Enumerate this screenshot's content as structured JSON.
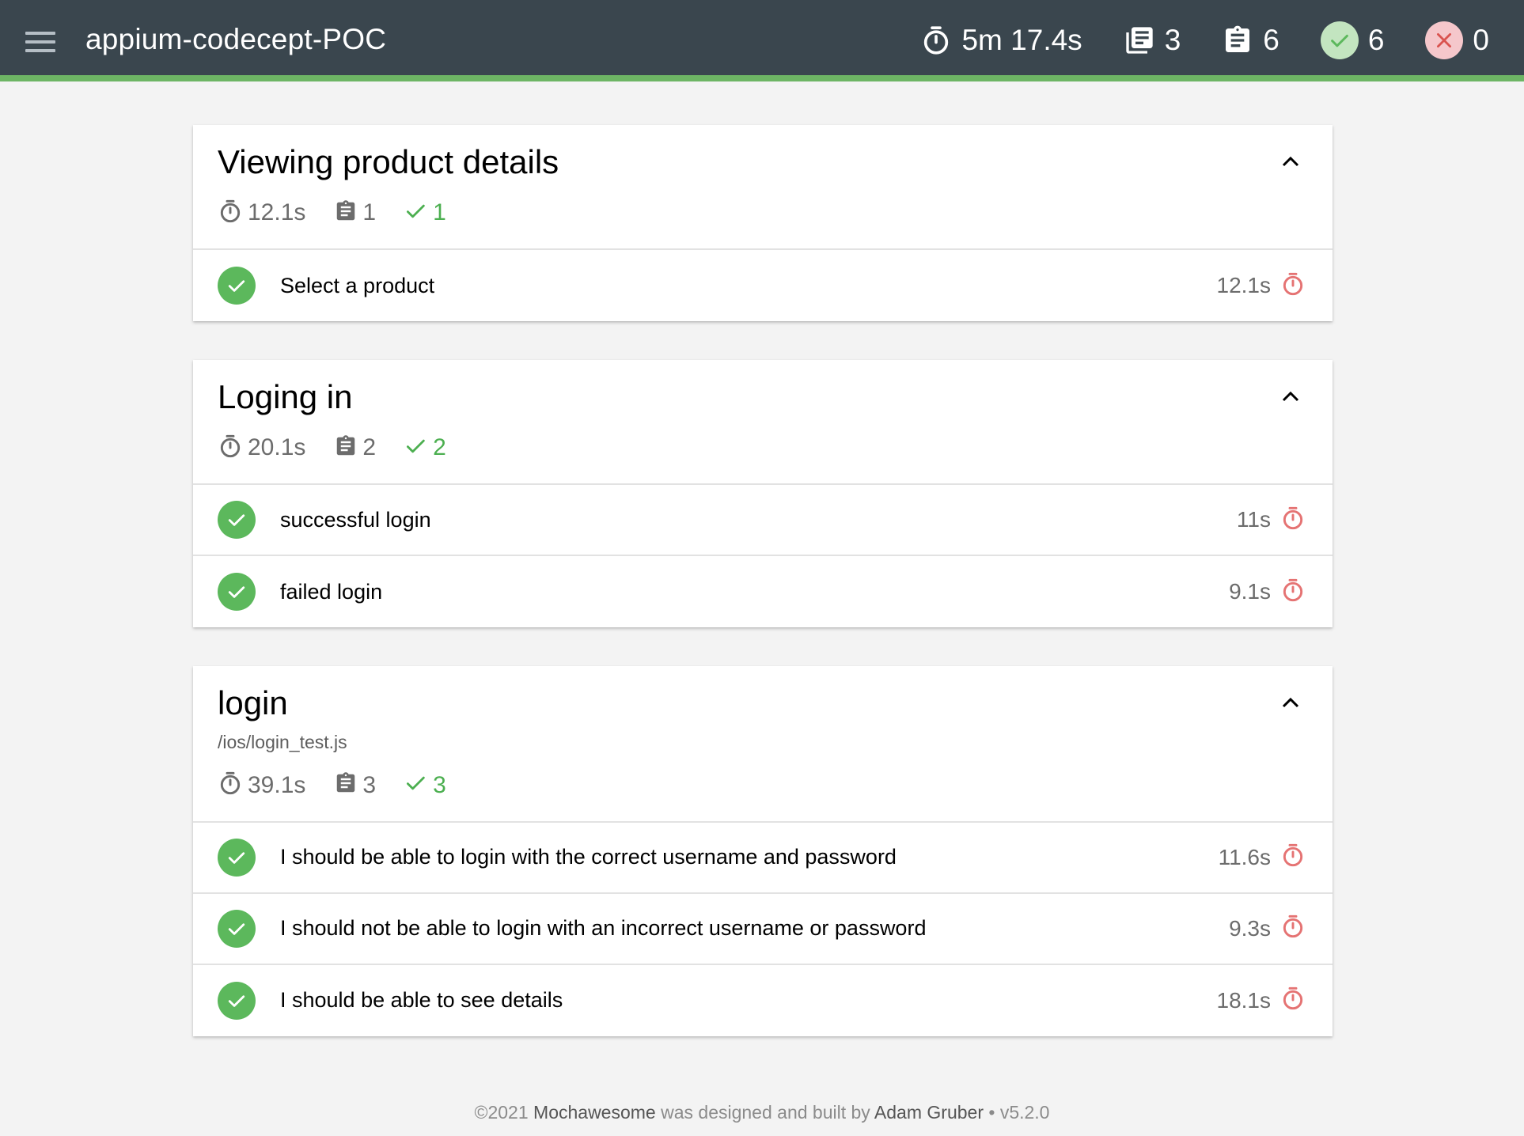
{
  "app": {
    "title": "appium-codecept-POC"
  },
  "topbar_stats": {
    "duration": "5m 17.4s",
    "suites": "3",
    "tests": "6",
    "passes": "6",
    "failures": "0"
  },
  "colors": {
    "topbar_bg": "#3a464e",
    "accent_green": "#6db564",
    "pass_green": "#5cb85c",
    "fail_red": "#d9534f",
    "duration_icon": "#e57373"
  },
  "suites": [
    {
      "title": "Viewing product details",
      "file": "",
      "duration": "12.1s",
      "tests_count": "1",
      "passes": "1",
      "tests": [
        {
          "title": "Select a product",
          "duration": "12.1s",
          "status": "passed"
        }
      ]
    },
    {
      "title": "Loging in",
      "file": "",
      "duration": "20.1s",
      "tests_count": "2",
      "passes": "2",
      "tests": [
        {
          "title": "successful login",
          "duration": "11s",
          "status": "passed"
        },
        {
          "title": "failed login",
          "duration": "9.1s",
          "status": "passed"
        }
      ]
    },
    {
      "title": "login",
      "file": "/ios/login_test.js",
      "duration": "39.1s",
      "tests_count": "3",
      "passes": "3",
      "tests": [
        {
          "title": "I should be able to login with the correct username and password",
          "duration": "11.6s",
          "status": "passed"
        },
        {
          "title": "I should not be able to login with an incorrect username or password",
          "duration": "9.3s",
          "status": "passed"
        },
        {
          "title": "I should be able to see details",
          "duration": "18.1s",
          "status": "passed"
        }
      ]
    }
  ],
  "footer": {
    "copyright": "©2021",
    "product": "Mochawesome",
    "middle": "was designed and built by",
    "author": "Adam Gruber",
    "version": "• v5.2.0"
  }
}
